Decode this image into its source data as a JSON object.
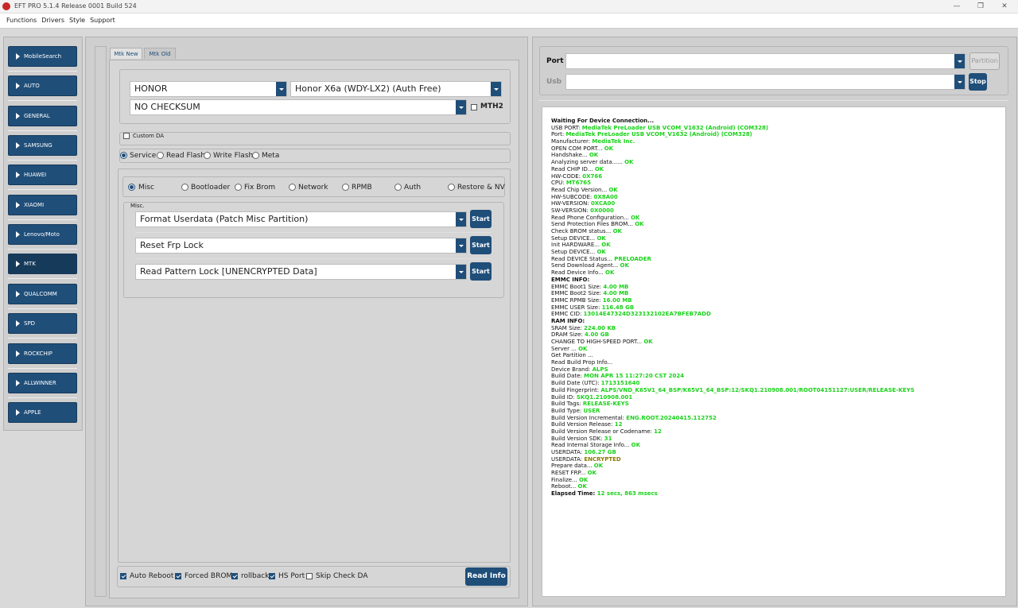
{
  "window": {
    "title": "EFT PRO 5.1.4 Release 0001 Build 524",
    "min_glyph": "—",
    "max_glyph": "❐",
    "close_glyph": "✕"
  },
  "menu": [
    "Functions",
    "Drivers",
    "Style",
    "Support"
  ],
  "sidebar": {
    "items": [
      {
        "label": "MobileSearch"
      },
      {
        "label": "AUTO"
      },
      {
        "label": "GENERAL"
      },
      {
        "label": "SAMSUNG"
      },
      {
        "label": "HUAWEI"
      },
      {
        "label": "XIAOMI"
      },
      {
        "label": "Lenovo/Moto"
      },
      {
        "label": "MTK",
        "active": true
      },
      {
        "label": "QUALCOMM"
      },
      {
        "label": "SPD"
      },
      {
        "label": "ROCKCHIP"
      },
      {
        "label": "ALLWINNER"
      },
      {
        "label": "APPLE"
      }
    ]
  },
  "tabs": [
    {
      "label": "Mtk New",
      "active": true
    },
    {
      "label": "Mtk Old",
      "active": false
    }
  ],
  "device": {
    "brand": "HONOR",
    "model": "Honor X6a (WDY-LX2) (Auth Free)",
    "checksum": "NO CHECKSUM",
    "mth2_label": "MTH2"
  },
  "custom_da": {
    "label": "Custom DA",
    "checked": false
  },
  "modes": [
    {
      "label": "Service",
      "selected": true
    },
    {
      "label": "Read Flash",
      "selected": false
    },
    {
      "label": "Write Flash",
      "selected": false
    },
    {
      "label": "Meta",
      "selected": false
    }
  ],
  "subtabs": [
    {
      "label": "Misc",
      "selected": true
    },
    {
      "label": "Bootloader",
      "selected": false
    },
    {
      "label": "Fix Brom",
      "selected": false
    },
    {
      "label": "Network",
      "selected": false
    },
    {
      "label": "RPMB",
      "selected": false
    },
    {
      "label": "Auth",
      "selected": false
    },
    {
      "label": "Restore & NV",
      "selected": false
    }
  ],
  "misc": {
    "group_label": "Misc.",
    "operations": [
      {
        "value": "Format Userdata (Patch Misc Partition)",
        "button": "Start"
      },
      {
        "value": "Reset Frp Lock",
        "button": "Start"
      },
      {
        "value": "Read Pattern Lock [UNENCRYPTED Data]",
        "button": "Start"
      }
    ]
  },
  "options": [
    {
      "label": "Auto Reboot",
      "checked": true
    },
    {
      "label": "Forced BROM",
      "checked": true
    },
    {
      "label": "rollback",
      "checked": true
    },
    {
      "label": "HS Port",
      "checked": true
    },
    {
      "label": "Skip Check DA",
      "checked": false
    }
  ],
  "read_info_label": "Read Info",
  "right": {
    "port_label": "Port",
    "usb_label": "Usb",
    "partition_label": "Partition",
    "stop_label": "Stop"
  },
  "colors": {
    "accent": "#1f4e79",
    "ok": "#19d219"
  },
  "log": [
    [
      {
        "t": "Waiting For Device Connection...",
        "c": "bold"
      }
    ],
    [
      {
        "t": "USB PORT: "
      },
      {
        "t": "MediaTek PreLoader USB VCOM_V1632 (Android) (COM328)",
        "c": "ok"
      }
    ],
    [
      {
        "t": "Port: "
      },
      {
        "t": "MediaTek PreLoader USB VCOM_V1632 (Android) (COM328)",
        "c": "ok"
      }
    ],
    [
      {
        "t": "Manufacturer: "
      },
      {
        "t": "MediaTek Inc.",
        "c": "ok"
      }
    ],
    [
      {
        "t": "OPEN COM PORT... "
      },
      {
        "t": "OK",
        "c": "ok"
      }
    ],
    [
      {
        "t": "Handshake... "
      },
      {
        "t": "OK",
        "c": "ok"
      }
    ],
    [
      {
        "t": "Analyzing server data...... "
      },
      {
        "t": "OK",
        "c": "ok"
      }
    ],
    [
      {
        "t": "Read CHIP ID... "
      },
      {
        "t": "OK",
        "c": "ok"
      }
    ],
    [
      {
        "t": "HW-CODE: "
      },
      {
        "t": "0X766",
        "c": "ok"
      }
    ],
    [
      {
        "t": "CPU: "
      },
      {
        "t": "MT6765",
        "c": "ok"
      }
    ],
    [
      {
        "t": "Read Chip Version... "
      },
      {
        "t": "OK",
        "c": "ok"
      }
    ],
    [
      {
        "t": "HW-SUBCODE: "
      },
      {
        "t": "0X8A00",
        "c": "ok"
      }
    ],
    [
      {
        "t": "HW-VERSION: "
      },
      {
        "t": "0XCA00",
        "c": "ok"
      }
    ],
    [
      {
        "t": "SW-VERSION: "
      },
      {
        "t": "0X0000",
        "c": "ok"
      }
    ],
    [
      {
        "t": "Read Phone Configuration... "
      },
      {
        "t": "OK",
        "c": "ok"
      }
    ],
    [
      {
        "t": "Send Protection Files BROM... "
      },
      {
        "t": "OK",
        "c": "ok"
      }
    ],
    [
      {
        "t": "Check BROM status... "
      },
      {
        "t": "OK",
        "c": "ok"
      }
    ],
    [
      {
        "t": "Setup DEVICE... "
      },
      {
        "t": "OK",
        "c": "ok"
      }
    ],
    [
      {
        "t": "Init HARDWARE... "
      },
      {
        "t": "OK",
        "c": "ok"
      }
    ],
    [
      {
        "t": "Setup DEVICE... "
      },
      {
        "t": "OK",
        "c": "ok"
      }
    ],
    [
      {
        "t": "Read DEVICE Status... "
      },
      {
        "t": "PRELOADER",
        "c": "ok"
      }
    ],
    [
      {
        "t": "Send Download Agent... "
      },
      {
        "t": "OK",
        "c": "ok"
      }
    ],
    [
      {
        "t": "Read Device Info... "
      },
      {
        "t": "OK",
        "c": "ok"
      }
    ],
    [
      {
        "t": "EMMC INFO:",
        "c": "bold"
      }
    ],
    [
      {
        "t": "EMMC Boot1 Size: "
      },
      {
        "t": "4.00 MB",
        "c": "ok"
      }
    ],
    [
      {
        "t": "EMMC Boot2 Size: "
      },
      {
        "t": "4.00 MB",
        "c": "ok"
      }
    ],
    [
      {
        "t": "EMMC RPMB Size: "
      },
      {
        "t": "16.00 MB",
        "c": "ok"
      }
    ],
    [
      {
        "t": "EMMC USER Size: "
      },
      {
        "t": "116.48 GB",
        "c": "ok"
      }
    ],
    [
      {
        "t": "EMMC CID: "
      },
      {
        "t": "13014E47324D323132102EA7BFEB7ADD",
        "c": "ok"
      }
    ],
    [
      {
        "t": "RAM INFO:",
        "c": "bold"
      }
    ],
    [
      {
        "t": "SRAM Size: "
      },
      {
        "t": "224.00 KB",
        "c": "ok"
      }
    ],
    [
      {
        "t": "DRAM Size: "
      },
      {
        "t": "4.00 GB",
        "c": "ok"
      }
    ],
    [
      {
        "t": "CHANGE TO HIGH-SPEED PORT... "
      },
      {
        "t": "OK",
        "c": "ok"
      }
    ],
    [
      {
        "t": "Server ... "
      },
      {
        "t": "OK",
        "c": "ok"
      }
    ],
    [
      {
        "t": "Get Partition ..."
      }
    ],
    [
      {
        "t": "Read Build Prop Info..."
      }
    ],
    [
      {
        "t": " Device Brand: "
      },
      {
        "t": "ALPS",
        "c": "ok"
      }
    ],
    [
      {
        "t": " Build Date: "
      },
      {
        "t": "MON APR 15 11:27:20 CST 2024",
        "c": "ok"
      }
    ],
    [
      {
        "t": " Build Date (UTC): "
      },
      {
        "t": "1713151640",
        "c": "ok"
      }
    ],
    [
      {
        "t": " Build Fingerprint: "
      },
      {
        "t": "ALPS/VND_K65V1_64_BSP/K65V1_64_BSP:12/SKQ1.210908.001/ROOT04151127:USER/RELEASE-KEYS",
        "c": "ok"
      }
    ],
    [
      {
        "t": " Build ID: "
      },
      {
        "t": "SKQ1.210908.001",
        "c": "ok"
      }
    ],
    [
      {
        "t": " Build Tags: "
      },
      {
        "t": "RELEASE-KEYS",
        "c": "ok"
      }
    ],
    [
      {
        "t": " Build Type: "
      },
      {
        "t": "USER",
        "c": "ok"
      }
    ],
    [
      {
        "t": " Build Version Incremental: "
      },
      {
        "t": "ENG.ROOT.20240415.112752",
        "c": "ok"
      }
    ],
    [
      {
        "t": " Build Version Release: "
      },
      {
        "t": "12",
        "c": "ok"
      }
    ],
    [
      {
        "t": " Build Version Release or Codename: "
      },
      {
        "t": "12",
        "c": "ok"
      }
    ],
    [
      {
        "t": " Build Version SDK: "
      },
      {
        "t": "31",
        "c": "ok"
      }
    ],
    [
      {
        "t": "Read Internal Storage Info... "
      },
      {
        "t": "OK",
        "c": "ok"
      }
    ],
    [
      {
        "t": "USERDATA: "
      },
      {
        "t": "106.27 GB",
        "c": "ok"
      }
    ],
    [
      {
        "t": "USERDATA: "
      },
      {
        "t": "ENCRYPTED",
        "c": "olive"
      }
    ],
    [
      {
        "t": "Prepare data... "
      },
      {
        "t": "OK",
        "c": "ok"
      }
    ],
    [
      {
        "t": "RESET FRP... "
      },
      {
        "t": "OK",
        "c": "ok"
      }
    ],
    [
      {
        "t": "Finalize... "
      },
      {
        "t": "OK",
        "c": "ok"
      }
    ],
    [
      {
        "t": "Reboot... "
      },
      {
        "t": "OK",
        "c": "ok"
      }
    ],
    [
      {
        "t": "Elapsed Time: ",
        "c": "bold"
      },
      {
        "t": "12 secs, 863 msecs",
        "c": "ok"
      }
    ]
  ]
}
